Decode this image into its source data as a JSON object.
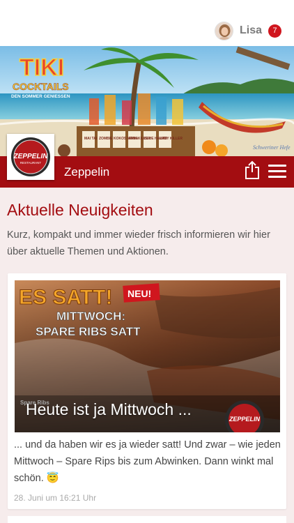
{
  "user": {
    "name": "Lisa",
    "notification_count": "7"
  },
  "banner": {
    "headline": "TIKI",
    "subheadline": "COCKTAILS",
    "tagline": "DEN SOMMER GENIESSEN",
    "drinks": [
      "MAI TAI",
      "ZOMBIE",
      "KOKOS MAMA",
      "PAIN KILLER",
      "BLUE HAWAII",
      "LADY KILLER"
    ],
    "signature": "Schweriner Hefe"
  },
  "restaurant": {
    "name": "Zeppelin",
    "logo_text": "ZEPPELIN",
    "logo_subtext": "RESTAURANT"
  },
  "section": {
    "title": "Aktuelle Neuigkeiten",
    "intro": "Kurz, kompakt und immer wieder frisch informieren wir hier über aktuelle Themen und Aktionen."
  },
  "post": {
    "image_title": "ES SATT!",
    "image_badge": "NEU!",
    "image_line1": "MITTWOCH:",
    "image_line2": "SPARE RIBS SATT",
    "image_small": "Spare Ribs",
    "image_logo": "ZEPPELIN",
    "caption": "Heute ist ja Mittwoch ...",
    "text": "... und da haben wir es ja wieder satt! Und zwar – wie jeden Mittwoch – Spare Rips bis zum Abwinken. Dann winkt mal schön. 😇",
    "date": "28. Juni um 16:21 Uhr"
  },
  "colors": {
    "brand_red": "#a30d11",
    "badge_red": "#d0161e",
    "background": "#f6ecec"
  },
  "icons": [
    "share-icon",
    "hamburger-menu-icon",
    "avatar"
  ]
}
